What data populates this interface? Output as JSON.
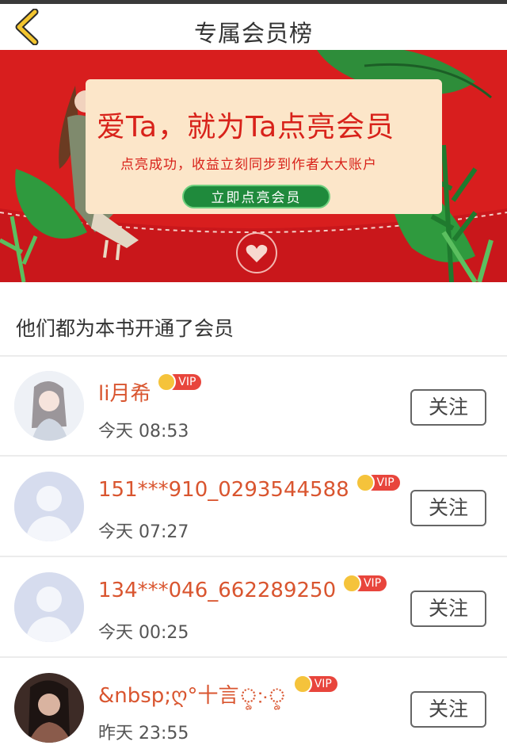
{
  "header": {
    "title": "专属会员榜",
    "back_icon": "chevron-left-icon"
  },
  "banner": {
    "headline": "爱Ta，就为Ta点亮会员",
    "subtitle": "点亮成功，收益立刻同步到作者大大账户",
    "button_label": "立即点亮会员",
    "colors": {
      "background": "#d81e1e",
      "card": "#fce6c9",
      "button": "#1f8a3c"
    }
  },
  "section": {
    "title": "他们都为本书开通了会员"
  },
  "members": [
    {
      "name": "li月希",
      "badge": "VIP",
      "time": "今天 08:53",
      "follow_label": "关注",
      "avatar": "girl-illustration"
    },
    {
      "name": "151***910_0293544588",
      "badge": "VIP",
      "time": "今天 07:27",
      "follow_label": "关注",
      "avatar": "default-user"
    },
    {
      "name": "134***046_662289250",
      "badge": "VIP",
      "time": "今天 00:25",
      "follow_label": "关注",
      "avatar": "default-user"
    },
    {
      "name": "&nbsp;ღ°十言ৢ჻ৢ",
      "badge": "VIP",
      "time": "昨天 23:55",
      "follow_label": "关注",
      "avatar": "dark-portrait"
    }
  ],
  "colors": {
    "name": "#d9552f",
    "vip": "#e8453c",
    "accent_yellow": "#f3c52f"
  }
}
